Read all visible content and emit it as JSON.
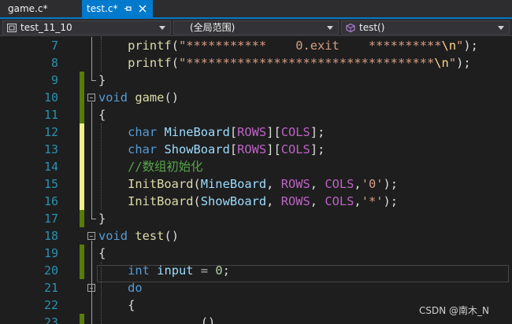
{
  "tabs": [
    {
      "label": "game.c*",
      "active": false
    },
    {
      "label": "test.c*",
      "active": true
    }
  ],
  "navbar": {
    "project": "test_11_10",
    "scope": "(全局范围)",
    "member": "test()"
  },
  "line_numbers": [
    "7",
    "8",
    "9",
    "10",
    "11",
    "12",
    "13",
    "14",
    "15",
    "16",
    "17",
    "18",
    "19",
    "20",
    "21",
    "22",
    "23"
  ],
  "code": {
    "l7": {
      "fn": "printf",
      "open": "(",
      "str_a": "\"***********    0.exit    **********",
      "esc": "\\n",
      "str_b": "\"",
      "close": ");"
    },
    "l8": {
      "fn": "printf",
      "open": "(",
      "str_a": "\"**********************************",
      "esc": "\\n",
      "str_b": "\"",
      "close": ");"
    },
    "l9": {
      "text": "}"
    },
    "l10": {
      "kw": "void",
      "fn": "game",
      "rest": "()"
    },
    "l11": {
      "text": "{"
    },
    "l12": {
      "kw": "char",
      "var": "MineBoard",
      "b1": "[",
      "m1": "ROWS",
      "b2": "][",
      "m2": "COLS",
      "b3": "];"
    },
    "l13": {
      "kw": "char",
      "var": "ShowBoard",
      "b1": "[",
      "m1": "ROWS",
      "b2": "][",
      "m2": "COLS",
      "b3": "];"
    },
    "l14": {
      "comment": "//数组初始化"
    },
    "l15": {
      "fn": "InitBoard",
      "open": "(",
      "a1": "MineBoard",
      "c1": ", ",
      "m1": "ROWS",
      "c2": ", ",
      "m2": "COLS",
      "c3": ",",
      "ch": "'0'",
      "close": ");"
    },
    "l16": {
      "fn": "InitBoard",
      "open": "(",
      "a1": "ShowBoard",
      "c1": ", ",
      "m1": "ROWS",
      "c2": ", ",
      "m2": "COLS",
      "c3": ",",
      "ch": "'*'",
      "close": ");"
    },
    "l17": {
      "text": "}"
    },
    "l18": {
      "kw": "void",
      "fn": "test",
      "rest": "()"
    },
    "l19": {
      "text": "{"
    },
    "l20": {
      "kw": "int",
      "var": "input",
      "op": " = ",
      "num": "0",
      "end": ";"
    },
    "l21": {
      "kw": "do"
    },
    "l22": {
      "text": "{"
    },
    "l23": {
      "partial": "()"
    }
  },
  "watermark": "CSDN @南木_N",
  "colors": {
    "background": "#1e1e1e",
    "accent": "#007acc",
    "line_number": "#2b91af",
    "keyword": "#569cd6",
    "function": "#dcdcaa",
    "string": "#d69d85",
    "macro": "#bd63c5",
    "variable": "#9cdcfe",
    "comment": "#57a64a",
    "number": "#b5cea8",
    "saved_change": "#587c0c",
    "unsaved_change": "#efef8f"
  },
  "icons": [
    "pin-icon",
    "close-icon",
    "project-icon",
    "scope-icon",
    "function-icon",
    "chevron-down-icon"
  ]
}
